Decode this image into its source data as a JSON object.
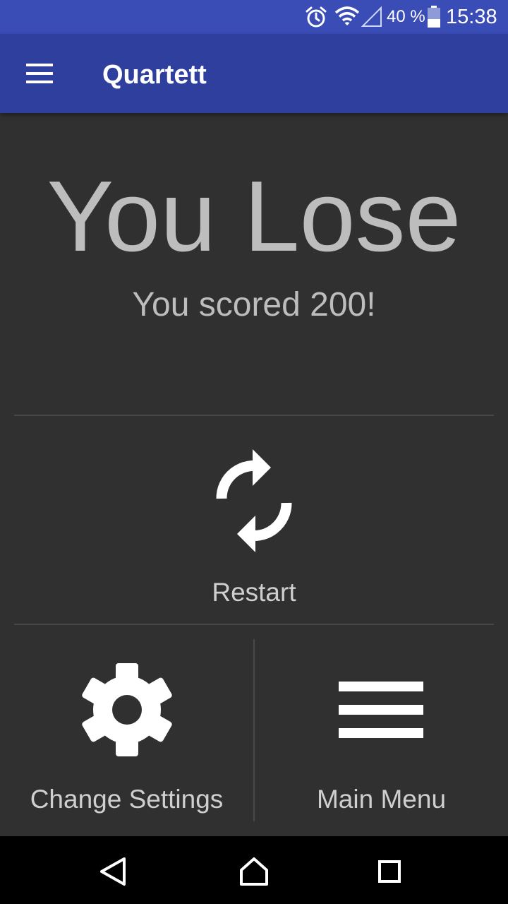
{
  "status_bar": {
    "battery_percent": "40 %",
    "time": "15:38",
    "icons": [
      "alarm-icon",
      "wifi-icon",
      "signal-icon",
      "battery-icon"
    ]
  },
  "app_bar": {
    "title": "Quartett",
    "menu_icon": "hamburger-menu-icon"
  },
  "result": {
    "title": "You Lose",
    "score_text": "You scored 200!"
  },
  "actions": {
    "restart": {
      "label": "Restart",
      "icon": "refresh-icon"
    },
    "settings": {
      "label": "Change Settings",
      "icon": "gear-icon"
    },
    "main_menu": {
      "label": "Main Menu",
      "icon": "menu-lines-icon"
    }
  },
  "nav_bar": {
    "icons": [
      "back-icon",
      "home-icon",
      "recents-icon"
    ]
  },
  "colors": {
    "status_bar": "#3a4cb6",
    "app_bar": "#2e3f9e",
    "background": "#303030",
    "text_secondary": "#bdbdbd",
    "icon_white": "#ffffff",
    "nav_bar": "#000000"
  }
}
